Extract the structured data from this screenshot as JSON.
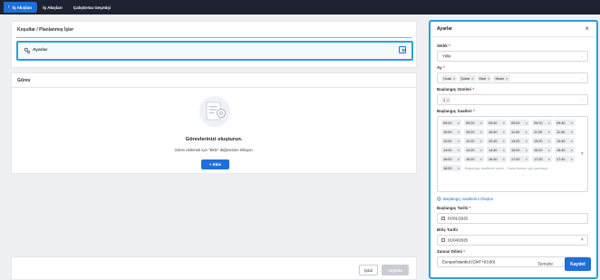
{
  "topbar": {
    "tabs": [
      {
        "label": "İş Akışları",
        "active": true
      },
      {
        "label": "İş Akışları",
        "active": false
      },
      {
        "label": "Çalıştırma Geçmişi",
        "active": false
      }
    ]
  },
  "schedule_card": {
    "title": "Koşullar / Planlanmış İşler",
    "row_label": "Ayarlar"
  },
  "task_card": {
    "title": "Görev",
    "empty_title": "Görevlerinizi oluşturun.",
    "empty_subtitle": "Görev eklemek için \"Ekle\" düğmesine tıklayın.",
    "add_button": "+ Ekle"
  },
  "footer": {
    "cancel_label": "İptal",
    "publish_label": "Yayınla"
  },
  "drawer": {
    "title": "Ayarlar",
    "close": "×",
    "frequency": {
      "label": "Sıklık",
      "value": "Yıllık"
    },
    "months": {
      "label": "Ay",
      "values": [
        "Ocak",
        "Şubat",
        "Mart",
        "Nisan"
      ]
    },
    "start_days": {
      "label": "Başlangıç Günleri",
      "values": [
        "1"
      ]
    },
    "start_times": {
      "label": "Başlangıç Saatleri",
      "values": [
        "09:00",
        "09:20",
        "09:40",
        "09:00",
        "09:20",
        "09:40",
        "10:00",
        "10:20",
        "10:40",
        "11:00",
        "11:20",
        "11:40",
        "12:00",
        "12:20",
        "12:40",
        "13:00",
        "13:20",
        "13:40",
        "14:00",
        "14:20",
        "14:40",
        "15:00",
        "15:20",
        "15:40",
        "16:00",
        "16:20",
        "16:40",
        "17:00",
        "17:20",
        "17:40",
        "18:00"
      ],
      "placeholder": "Başlangıç saatlerini seçin... Daha fazlası için yazmaya"
    },
    "generate_link": "Başlangıç Saatlerini Oluştur",
    "start_date": {
      "label": "Başlangıç Tarihi",
      "value": "01/01/2025"
    },
    "end_date": {
      "label": "Bitiş Tarihi",
      "value": "01/04/2025"
    },
    "timezone": {
      "label": "Zaman Dilimi",
      "value": "Europe/Istanbul (GMT+03:00)"
    },
    "clear_label": "Temizle",
    "save_label": "Kaydet"
  },
  "colors": {
    "accent": "#1e6fd9",
    "highlight": "#2aa0d8",
    "topbar": "#1c2231"
  },
  "icons": [
    "chevron-left-icon",
    "gear-icon",
    "edit-icon",
    "document-illustration",
    "calendar-icon",
    "plus-circle-icon",
    "close-icon",
    "chevron-down-icon"
  ]
}
